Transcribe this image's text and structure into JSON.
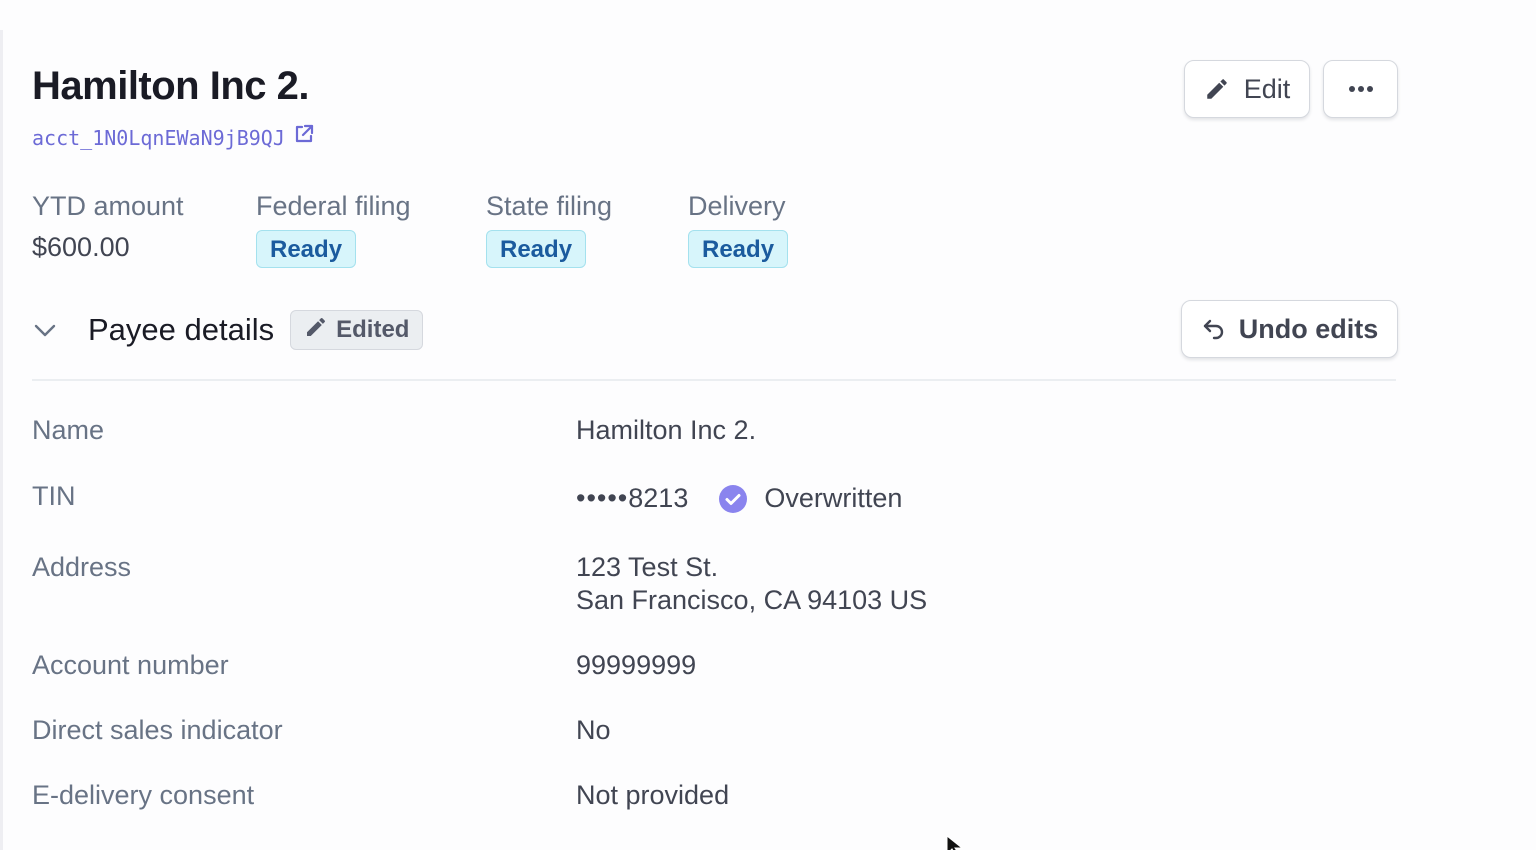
{
  "header": {
    "title": "Hamilton Inc 2.",
    "account_id": "acct_1N0LqnEWaN9jB9QJ",
    "edit_label": "Edit",
    "more_label": "•••"
  },
  "summary": [
    {
      "label": "YTD amount",
      "value": "$600.00"
    },
    {
      "label": "Federal filing",
      "status": "Ready"
    },
    {
      "label": "State filing",
      "status": "Ready"
    },
    {
      "label": "Delivery",
      "status": "Ready"
    }
  ],
  "section": {
    "title": "Payee details",
    "edited_badge": "Edited",
    "undo_label": "Undo edits"
  },
  "details": {
    "name": {
      "label": "Name",
      "value": "Hamilton Inc 2."
    },
    "tin": {
      "label": "TIN",
      "mask": "•••••",
      "last4": "8213",
      "status": "Overwritten"
    },
    "address": {
      "label": "Address",
      "line1": "123 Test St.",
      "line2": "San Francisco, CA 94103 US"
    },
    "account_number": {
      "label": "Account number",
      "value": "99999999"
    },
    "direct_sales": {
      "label": "Direct sales indicator",
      "value": "No"
    },
    "e_delivery": {
      "label": "E-delivery consent",
      "value": "Not provided"
    }
  },
  "colors": {
    "accent": "#6c6ad6",
    "ready_bg": "#d7f5fb",
    "ready_text": "#1b5b9e",
    "overwritten_check": "#8a84ee"
  }
}
